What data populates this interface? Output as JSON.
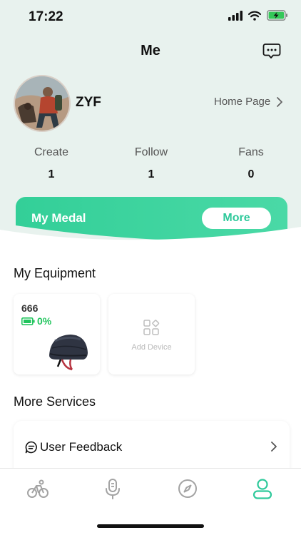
{
  "status_bar": {
    "time": "17:22"
  },
  "header": {
    "title": "Me"
  },
  "profile": {
    "username": "ZYF",
    "home_page_label": "Home Page"
  },
  "stats": [
    {
      "label": "Create",
      "value": "1"
    },
    {
      "label": "Follow",
      "value": "1"
    },
    {
      "label": "Fans",
      "value": "0"
    }
  ],
  "medal": {
    "title": "My Medal",
    "more_label": "More"
  },
  "equipment": {
    "title": "My Equipment",
    "device": {
      "name": "666",
      "battery": "0%"
    },
    "add_label": "Add Device"
  },
  "services": {
    "title": "More Services",
    "items": [
      {
        "label": "User Feedback"
      }
    ]
  },
  "tabs": [
    {
      "icon": "cycling-icon"
    },
    {
      "icon": "microphone-icon"
    },
    {
      "icon": "compass-icon"
    },
    {
      "icon": "profile-icon"
    }
  ],
  "colors": {
    "accent": "#2fc99b",
    "battery": "#22c55e",
    "background": "#e8f2ee"
  }
}
